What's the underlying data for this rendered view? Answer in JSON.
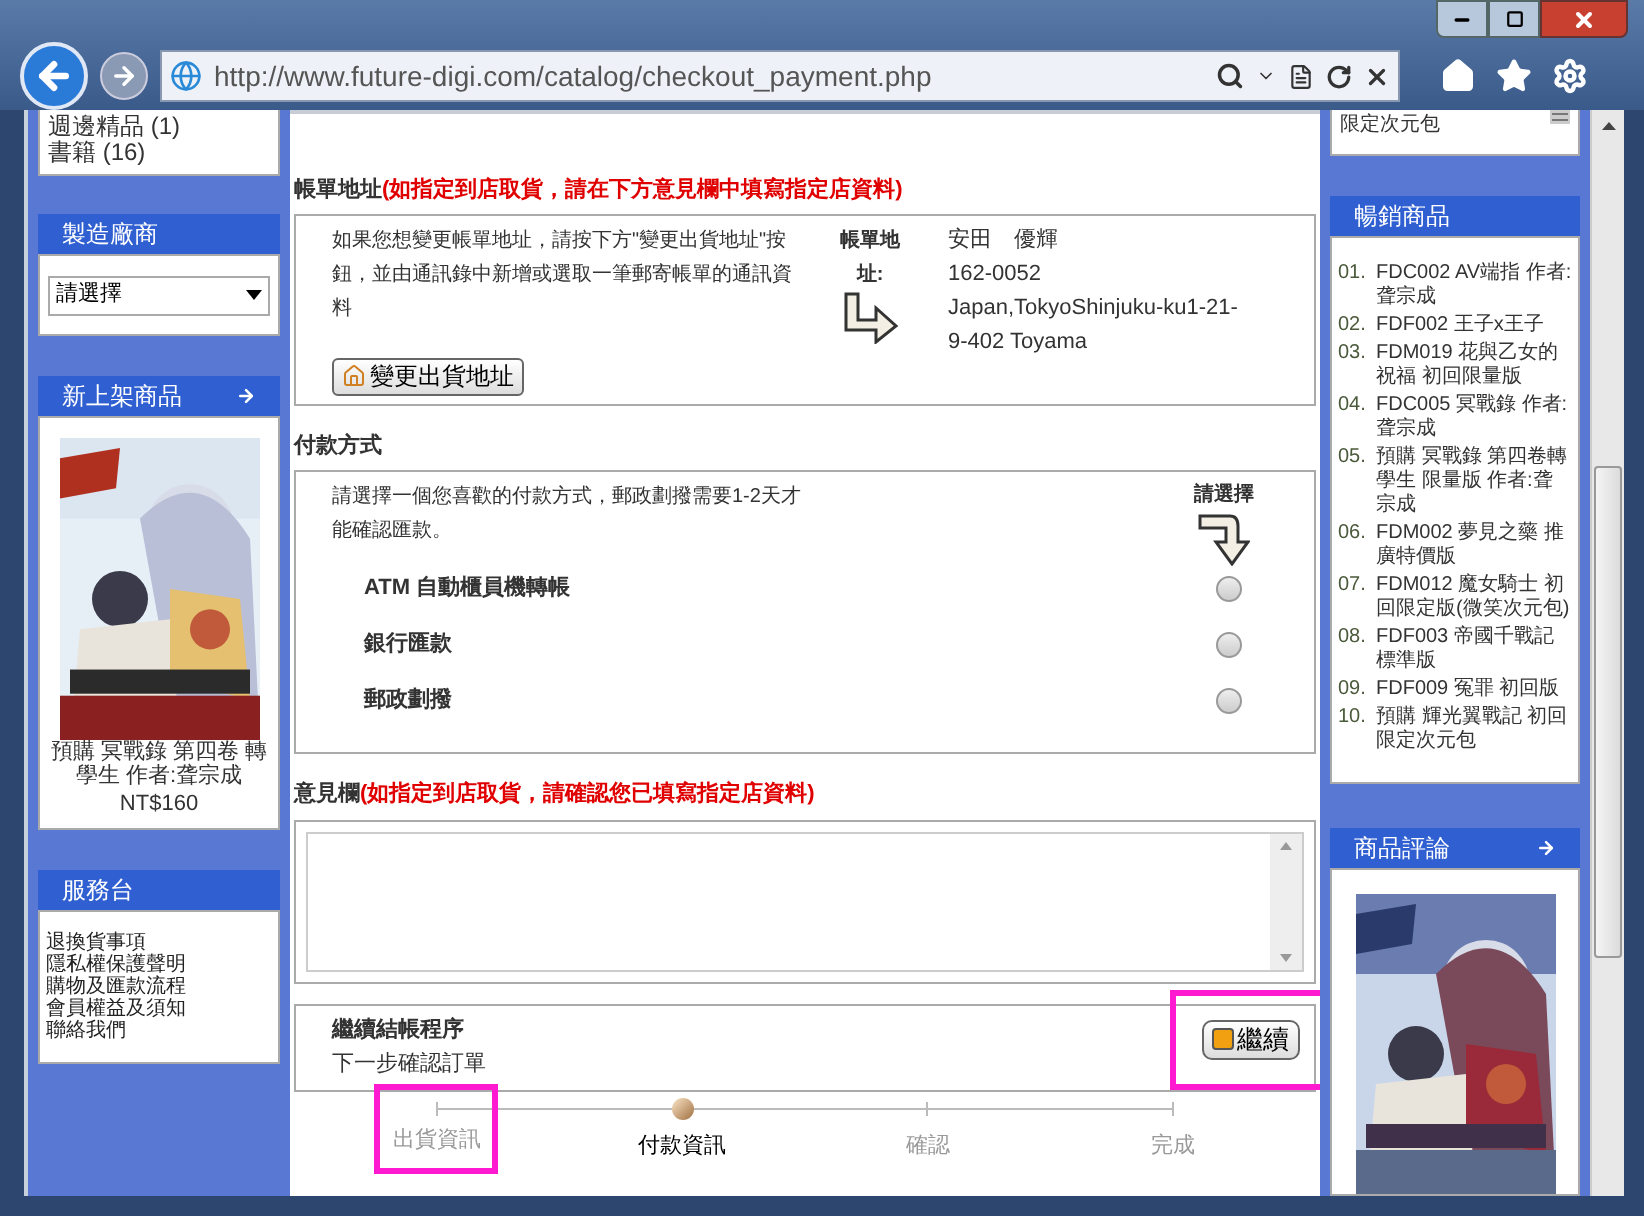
{
  "browser": {
    "url": "http://www.future-digi.com/catalog/checkout_payment.php"
  },
  "left_sidebar": {
    "categories": [
      "週邊精品 (1)",
      "書籍 (16)"
    ],
    "manufacturers": {
      "title": "製造廠商",
      "select": "請選擇"
    },
    "new_products": {
      "title": "新上架商品",
      "product": {
        "kind": "picture",
        "name": "預購 冥戰錄 第四卷 轉學生 作者:聋宗成",
        "price": "NT$160"
      }
    },
    "help_desk": {
      "title": "服務台",
      "links": [
        "退換貨事項",
        "隱私權保護聲明",
        "購物及匯款流程",
        "會員權益及須知",
        "聯絡我們"
      ]
    }
  },
  "billing": {
    "title": "帳單地址",
    "note": "(如指定到店取貨，請在下方意見欄中填寫指定店資料)",
    "description": "如果您想變更帳單地址，請按下方\"變更出貨地址\"按鈕，並由通訊錄中新增或選取一筆郵寄帳單的通訊資料",
    "button": "變更出貨地址",
    "address_label": "帳單地址:",
    "address": [
      "安田　優輝",
      "162-0052",
      "Japan,TokyoShinjuku-ku1-21-9-402 Toyama"
    ]
  },
  "payment": {
    "title": "付款方式",
    "description": "請選擇一個您喜歡的付款方式，郵政劃撥需要1-2天才能確認匯款。",
    "prompt": "請選擇",
    "options": [
      {
        "label": "ATM 自動櫃員機轉帳",
        "selected": false
      },
      {
        "label": "銀行匯款",
        "selected": false
      },
      {
        "label": "郵政劃撥",
        "selected": false
      }
    ]
  },
  "comments": {
    "title": "意見欄",
    "note": "(如指定到店取貨，請確認您已填寫指定店資料)"
  },
  "continue": {
    "title": "繼續結帳程序",
    "subtitle": "下一步確認訂單",
    "button": "繼續",
    "highlighted": true
  },
  "steps": [
    {
      "label": "出貨資訊",
      "current": false,
      "highlighted": true
    },
    {
      "label": "付款資訊",
      "current": true,
      "highlighted": false
    },
    {
      "label": "確認",
      "current": false,
      "highlighted": false
    },
    {
      "label": "完成",
      "current": false,
      "highlighted": false
    }
  ],
  "right_sidebar": {
    "top_item": "限定次元包",
    "bestsellers": {
      "title": "暢銷商品",
      "items": [
        {
          "number": "01.",
          "name": "FDC002 AV端指 作者:聋宗成"
        },
        {
          "number": "02.",
          "name": "FDF002 王子x王子"
        },
        {
          "number": "03.",
          "name": "FDM019 花與乙女的祝福 初回限量版"
        },
        {
          "number": "04.",
          "name": "FDC005 冥戰錄 作者:聋宗成"
        },
        {
          "number": "05.",
          "name": "預購 冥戰錄 第四卷轉學生 限量版 作者:聋宗成"
        },
        {
          "number": "06.",
          "name": "FDM002 夢見之藥 推廣特價版"
        },
        {
          "number": "07.",
          "name": "FDM012 魔女騎士 初回限定版(微笑次元包)"
        },
        {
          "number": "08.",
          "name": "FDF003 帝國千戰記標準版"
        },
        {
          "number": "09.",
          "name": "FDF009 冤罪 初回版"
        },
        {
          "number": "10.",
          "name": "預購 輝光翼戰記 初回限定次元包"
        }
      ]
    },
    "reviews": {
      "title": "商品評論"
    }
  }
}
